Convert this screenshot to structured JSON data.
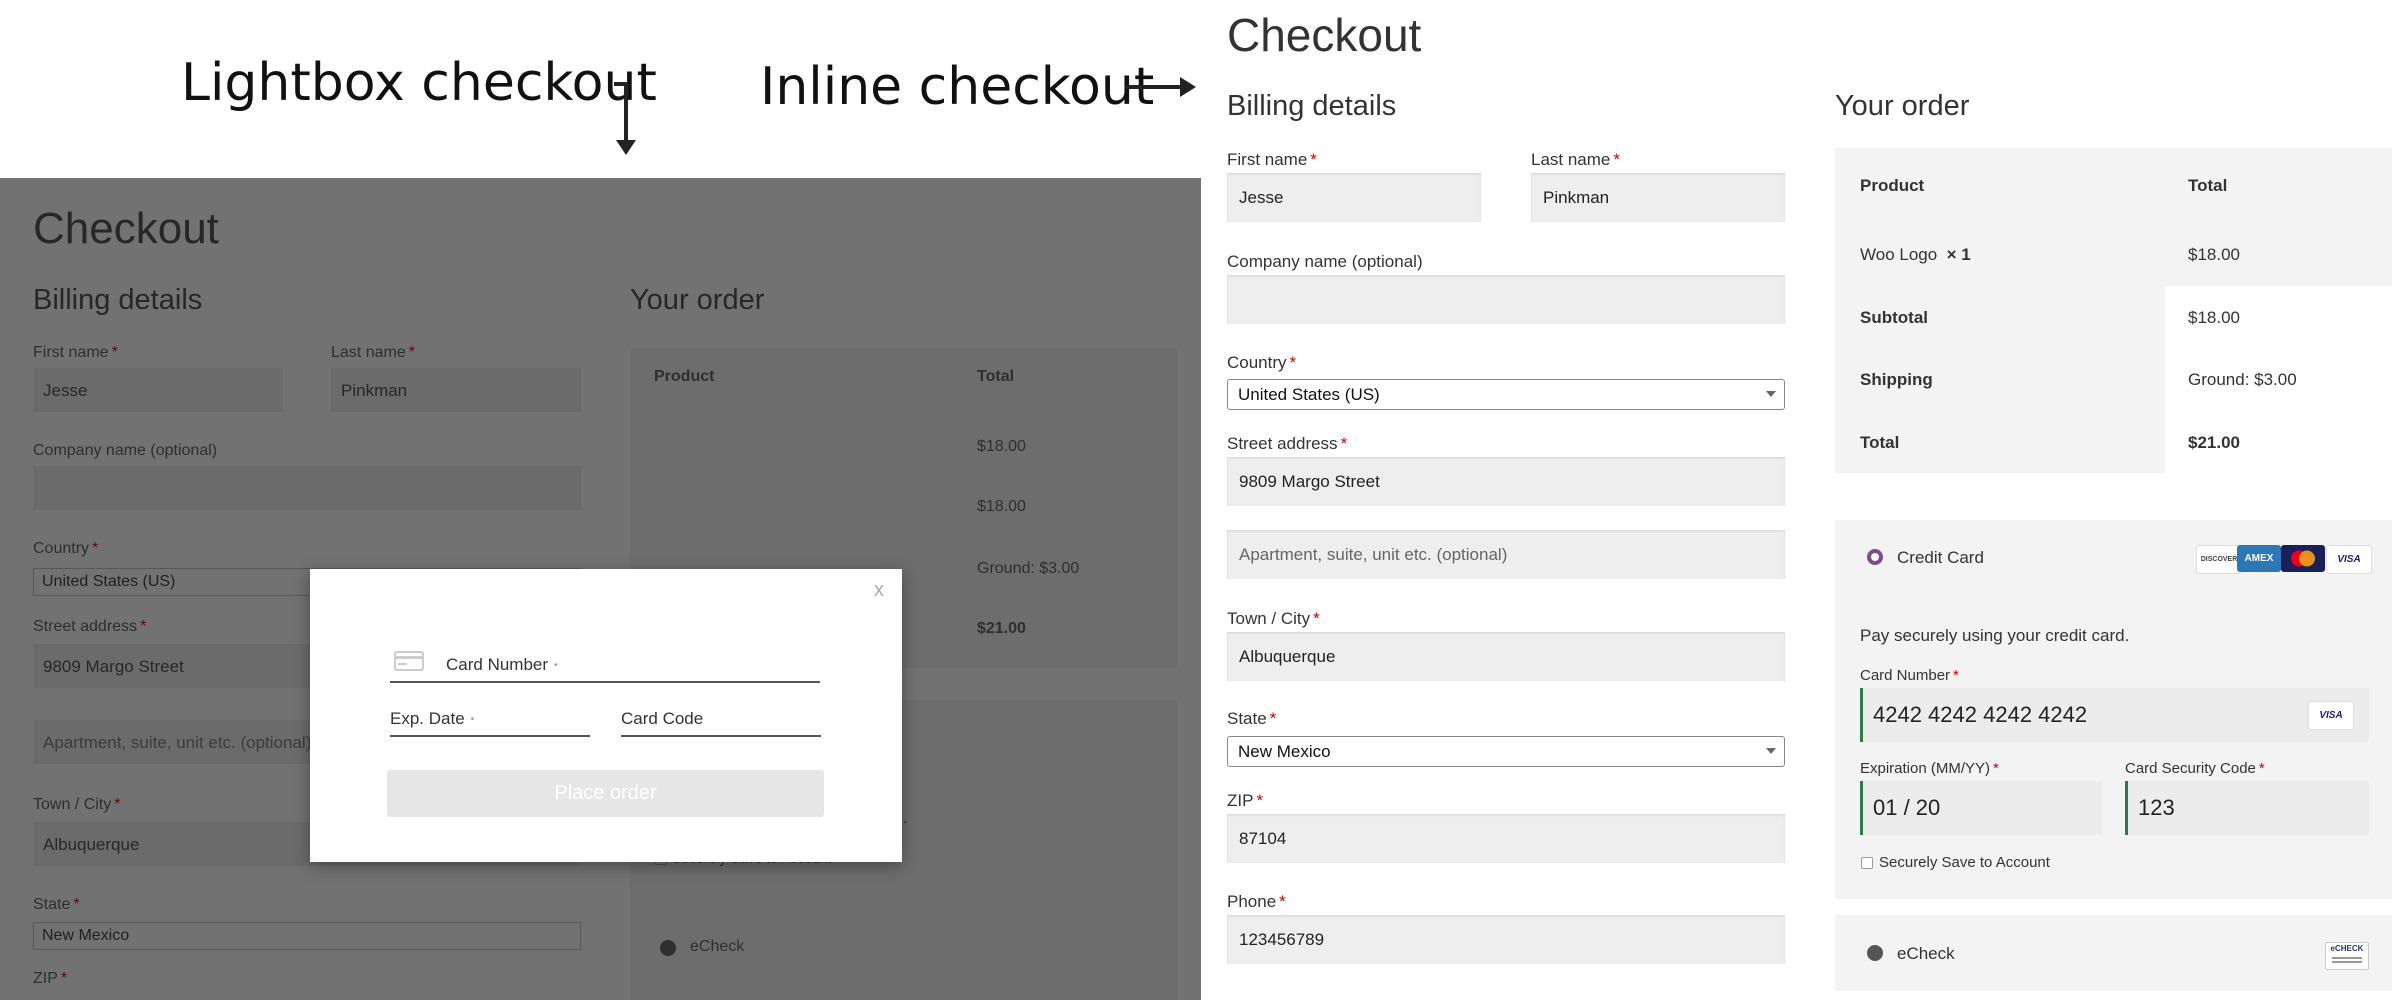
{
  "captions": {
    "lightbox": "Lightbox checkout",
    "inline": "Inline checkout",
    "arrow_right": "→",
    "arrow_down": "↓"
  },
  "checkout_title": "Checkout",
  "billing": {
    "heading": "Billing details",
    "first_name": {
      "label": "First name",
      "value": "Jesse"
    },
    "last_name": {
      "label": "Last name",
      "value": "Pinkman"
    },
    "company": {
      "label": "Company name (optional)",
      "value": ""
    },
    "country": {
      "label": "Country",
      "value": "United States (US)"
    },
    "street": {
      "label": "Street address",
      "value": "9809 Margo Street",
      "placeholder2": "Apartment, suite, unit etc. (optional)"
    },
    "city": {
      "label": "Town / City",
      "value": "Albuquerque"
    },
    "state": {
      "label": "State",
      "value": "New Mexico"
    },
    "zip": {
      "label": "ZIP",
      "value": "87104"
    },
    "phone": {
      "label": "Phone",
      "value": "123456789"
    },
    "required_mark": "*"
  },
  "order": {
    "heading": "Your order",
    "col_product": "Product",
    "col_total": "Total",
    "item_name": "Woo Logo",
    "item_qty": "× 1",
    "item_total": "$18.00",
    "subtotal_label": "Subtotal",
    "subtotal_value": "$18.00",
    "shipping_label": "Shipping",
    "shipping_value": "Ground: $3.00",
    "total_label": "Total",
    "total_value": "$21.00"
  },
  "payment": {
    "credit_card_label": "Credit Card",
    "description": "Pay securely using your credit card.",
    "card_number_label": "Card Number",
    "card_number_value": "4242 4242 4242 4242",
    "expiration_label": "Expiration (MM/YY)",
    "expiration_value": "01 / 20",
    "csc_label": "Card Security Code",
    "csc_value": "123",
    "save_label": "Securely Save to Account",
    "echeck_label": "eCheck",
    "logos": {
      "discover": "DISCOVER",
      "amex": "AMEX",
      "visa": "VISA",
      "echeck": "eCHECK"
    }
  },
  "modal": {
    "close": "x",
    "card_number_label": "Card Number",
    "exp_label": "Exp. Date",
    "card_code_label": "Card Code",
    "place_order": "Place order",
    "required_dot": "•"
  },
  "colors": {
    "accent_green": "#2a7a4a",
    "radio_purple": "#7b4f8a",
    "required_red": "#cc0000"
  }
}
